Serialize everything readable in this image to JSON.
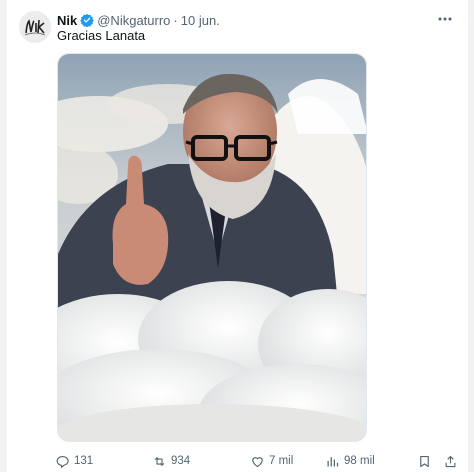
{
  "tweet": {
    "author_name": "Nik",
    "handle": "@Nikgaturro",
    "separator": "·",
    "date": "10 jun.",
    "text": "Gracias Lanata",
    "avatar_logo_text": "Nik",
    "verified_color": "#1d9bf0"
  },
  "actions": {
    "replies": "131",
    "retweets": "934",
    "likes": "7 mil",
    "views": "98 mil"
  },
  "icons": {
    "more": "more-dots-icon",
    "reply": "reply-icon",
    "retweet": "retweet-icon",
    "like": "heart-icon",
    "views": "views-icon",
    "bookmark": "bookmark-icon",
    "share": "share-icon"
  }
}
